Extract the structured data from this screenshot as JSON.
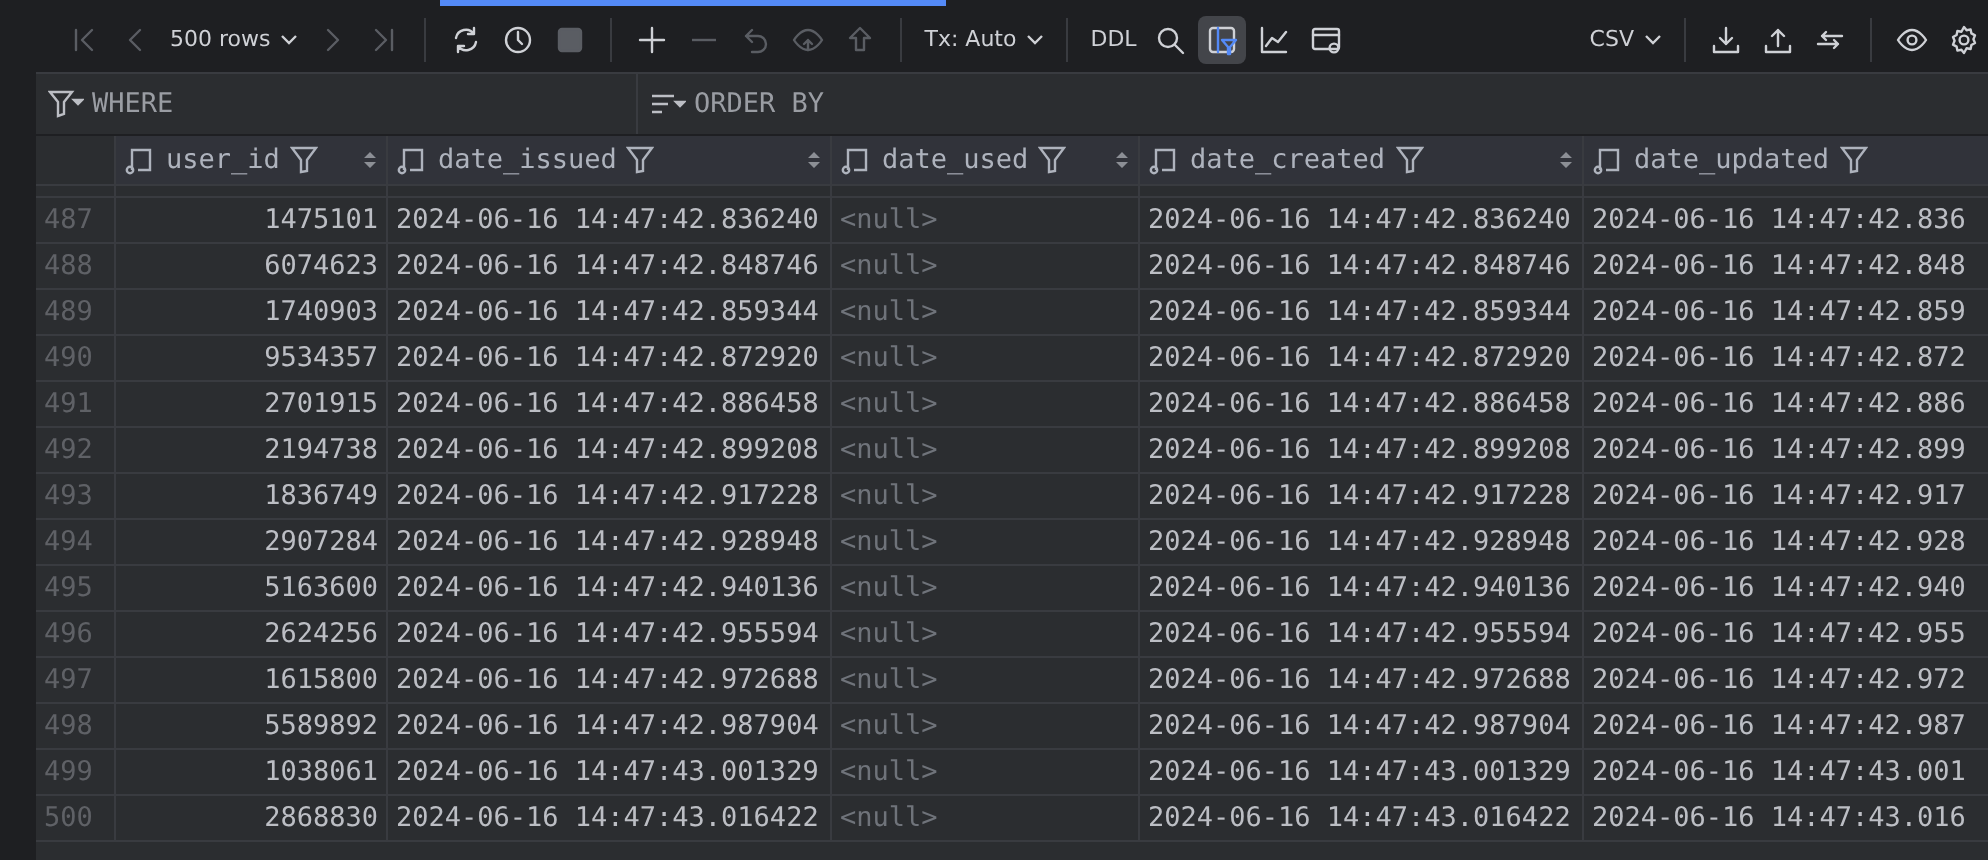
{
  "toolbar": {
    "items": [
      {
        "kind": "first",
        "disabled": true
      },
      {
        "kind": "prev",
        "disabled": true
      },
      {
        "kind": "menu",
        "label": "500 rows"
      },
      {
        "kind": "next",
        "disabled": true
      },
      {
        "kind": "last",
        "disabled": true
      },
      {
        "kind": "sep"
      },
      {
        "kind": "refresh",
        "disabled": false
      },
      {
        "kind": "clock",
        "disabled": false
      },
      {
        "kind": "stop",
        "disabled": true
      },
      {
        "kind": "sep"
      },
      {
        "kind": "plus",
        "disabled": false
      },
      {
        "kind": "minus",
        "disabled": true
      },
      {
        "kind": "revert",
        "disabled": true
      },
      {
        "kind": "preview",
        "disabled": true
      },
      {
        "kind": "submit",
        "disabled": true
      },
      {
        "kind": "sep"
      },
      {
        "kind": "menu",
        "label": "Tx: Auto"
      },
      {
        "kind": "sep"
      },
      {
        "kind": "text",
        "label": "DDL"
      },
      {
        "kind": "search",
        "disabled": false
      },
      {
        "kind": "filtertable",
        "disabled": false,
        "selected": true
      },
      {
        "kind": "chart",
        "disabled": false
      },
      {
        "kind": "viewer",
        "disabled": false
      },
      {
        "kind": "spacer"
      },
      {
        "kind": "menu",
        "label": "CSV"
      },
      {
        "kind": "sep"
      },
      {
        "kind": "download",
        "disabled": false
      },
      {
        "kind": "upload",
        "disabled": false
      },
      {
        "kind": "compare",
        "disabled": false
      },
      {
        "kind": "sep"
      },
      {
        "kind": "eye",
        "disabled": false
      },
      {
        "kind": "gear",
        "disabled": false
      }
    ]
  },
  "filters": {
    "where": {
      "placeholder": "WHERE"
    },
    "order_by": {
      "placeholder": "ORDER BY"
    }
  },
  "table": {
    "columns": [
      {
        "name": "user_id",
        "kind": "number"
      },
      {
        "name": "date_issued",
        "kind": "timestamp"
      },
      {
        "name": "date_used",
        "kind": "null"
      },
      {
        "name": "date_created",
        "kind": "timestamp"
      },
      {
        "name": "date_updated",
        "kind": "timestamp"
      }
    ],
    "rows": [
      {
        "number": "487",
        "cells": [
          "1475101",
          "2024-06-16 14:47:42.836240",
          "<null>",
          "2024-06-16 14:47:42.836240",
          "2024-06-16 14:47:42.836"
        ]
      },
      {
        "number": "488",
        "cells": [
          "6074623",
          "2024-06-16 14:47:42.848746",
          "<null>",
          "2024-06-16 14:47:42.848746",
          "2024-06-16 14:47:42.848"
        ]
      },
      {
        "number": "489",
        "cells": [
          "1740903",
          "2024-06-16 14:47:42.859344",
          "<null>",
          "2024-06-16 14:47:42.859344",
          "2024-06-16 14:47:42.859"
        ]
      },
      {
        "number": "490",
        "cells": [
          "9534357",
          "2024-06-16 14:47:42.872920",
          "<null>",
          "2024-06-16 14:47:42.872920",
          "2024-06-16 14:47:42.872"
        ]
      },
      {
        "number": "491",
        "cells": [
          "2701915",
          "2024-06-16 14:47:42.886458",
          "<null>",
          "2024-06-16 14:47:42.886458",
          "2024-06-16 14:47:42.886"
        ]
      },
      {
        "number": "492",
        "cells": [
          "2194738",
          "2024-06-16 14:47:42.899208",
          "<null>",
          "2024-06-16 14:47:42.899208",
          "2024-06-16 14:47:42.899"
        ]
      },
      {
        "number": "493",
        "cells": [
          "1836749",
          "2024-06-16 14:47:42.917228",
          "<null>",
          "2024-06-16 14:47:42.917228",
          "2024-06-16 14:47:42.917"
        ]
      },
      {
        "number": "494",
        "cells": [
          "2907284",
          "2024-06-16 14:47:42.928948",
          "<null>",
          "2024-06-16 14:47:42.928948",
          "2024-06-16 14:47:42.928"
        ]
      },
      {
        "number": "495",
        "cells": [
          "5163600",
          "2024-06-16 14:47:42.940136",
          "<null>",
          "2024-06-16 14:47:42.940136",
          "2024-06-16 14:47:42.940"
        ]
      },
      {
        "number": "496",
        "cells": [
          "2624256",
          "2024-06-16 14:47:42.955594",
          "<null>",
          "2024-06-16 14:47:42.955594",
          "2024-06-16 14:47:42.955"
        ]
      },
      {
        "number": "497",
        "cells": [
          "1615800",
          "2024-06-16 14:47:42.972688",
          "<null>",
          "2024-06-16 14:47:42.972688",
          "2024-06-16 14:47:42.972"
        ]
      },
      {
        "number": "498",
        "cells": [
          "5589892",
          "2024-06-16 14:47:42.987904",
          "<null>",
          "2024-06-16 14:47:42.987904",
          "2024-06-16 14:47:42.987"
        ]
      },
      {
        "number": "499",
        "cells": [
          "1038061",
          "2024-06-16 14:47:43.001329",
          "<null>",
          "2024-06-16 14:47:43.001329",
          "2024-06-16 14:47:43.001"
        ]
      },
      {
        "number": "500",
        "cells": [
          "2868830",
          "2024-06-16 14:47:43.016422",
          "<null>",
          "2024-06-16 14:47:43.016422",
          "2024-06-16 14:47:43.016"
        ]
      }
    ]
  }
}
